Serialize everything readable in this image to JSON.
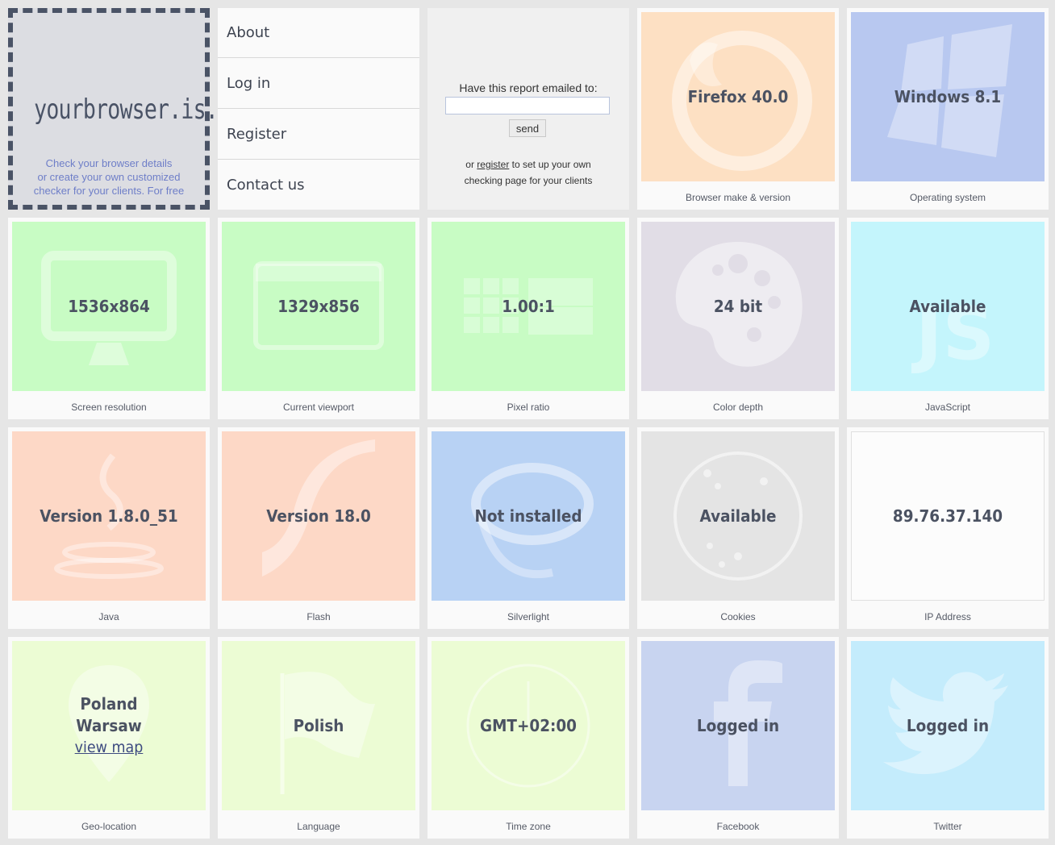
{
  "logo": {
    "title": "yourbrowser.is...",
    "tagline_1": "Check your browser details",
    "tagline_2": "or create your own customized",
    "tagline_3": "checker for your clients. For free"
  },
  "menu": {
    "items": [
      {
        "label": "About"
      },
      {
        "label": "Log in"
      },
      {
        "label": "Register"
      },
      {
        "label": "Contact us"
      }
    ]
  },
  "email": {
    "label": "Have this report emailed to:",
    "input_value": "",
    "send_label": "send",
    "note_prefix": "or",
    "register_link": "register",
    "note_suffix": "to set up your own",
    "note_line2": "checking page for your clients"
  },
  "tiles": {
    "browser": {
      "value": "Firefox 40.0",
      "caption": "Browser make & version",
      "color": "#fde0c3",
      "icon": "firefox-icon"
    },
    "os": {
      "value": "Windows 8.1",
      "caption": "Operating system",
      "color": "#b8c8f0",
      "icon": "windows-icon"
    },
    "screen": {
      "value": "1536x864",
      "caption": "Screen resolution",
      "color": "#c8fcc4",
      "icon": "monitor-icon"
    },
    "viewport": {
      "value": "1329x856",
      "caption": "Current viewport",
      "color": "#c8fcc4",
      "icon": "browser-window-icon"
    },
    "pixel": {
      "value": "1.00:1",
      "caption": "Pixel ratio",
      "color": "#c8fcc4",
      "icon": "pixel-grid-icon"
    },
    "color": {
      "value": "24 bit",
      "caption": "Color depth",
      "color": "#e1dde6",
      "icon": "palette-icon"
    },
    "js": {
      "value": "Available",
      "caption": "JavaScript",
      "color": "#c4f5fc",
      "icon": "javascript-icon"
    },
    "java": {
      "value": "Version 1.8.0_51",
      "caption": "Java",
      "color": "#fdd8c6",
      "icon": "java-cup-icon"
    },
    "flash": {
      "value": "Version 18.0",
      "caption": "Flash",
      "color": "#fdd8c6",
      "icon": "flash-icon"
    },
    "silverlight": {
      "value": "Not installed",
      "caption": "Silverlight",
      "color": "#b8d2f4",
      "icon": "silverlight-icon"
    },
    "cookies": {
      "value": "Available",
      "caption": "Cookies",
      "color": "#e4e4e4",
      "icon": "cookie-icon"
    },
    "ip": {
      "value": "89.76.37.140",
      "caption": "IP Address",
      "color": "#fcfcfc",
      "icon": ""
    },
    "geo": {
      "country": "Poland",
      "city": "Warsaw",
      "link": "view map",
      "caption": "Geo-location",
      "color": "#ecfcd4",
      "icon": "map-pin-icon"
    },
    "language": {
      "value": "Polish",
      "caption": "Language",
      "color": "#ecfcd4",
      "icon": "flag-icon"
    },
    "timezone": {
      "value": "GMT+02:00",
      "caption": "Time zone",
      "color": "#ecfcd4",
      "icon": "clock-icon"
    },
    "facebook": {
      "value": "Logged in",
      "caption": "Facebook",
      "color": "#c8d4f0",
      "icon": "facebook-icon"
    },
    "twitter": {
      "value": "Logged in",
      "caption": "Twitter",
      "color": "#c4ecfc",
      "icon": "twitter-bird-icon"
    }
  }
}
